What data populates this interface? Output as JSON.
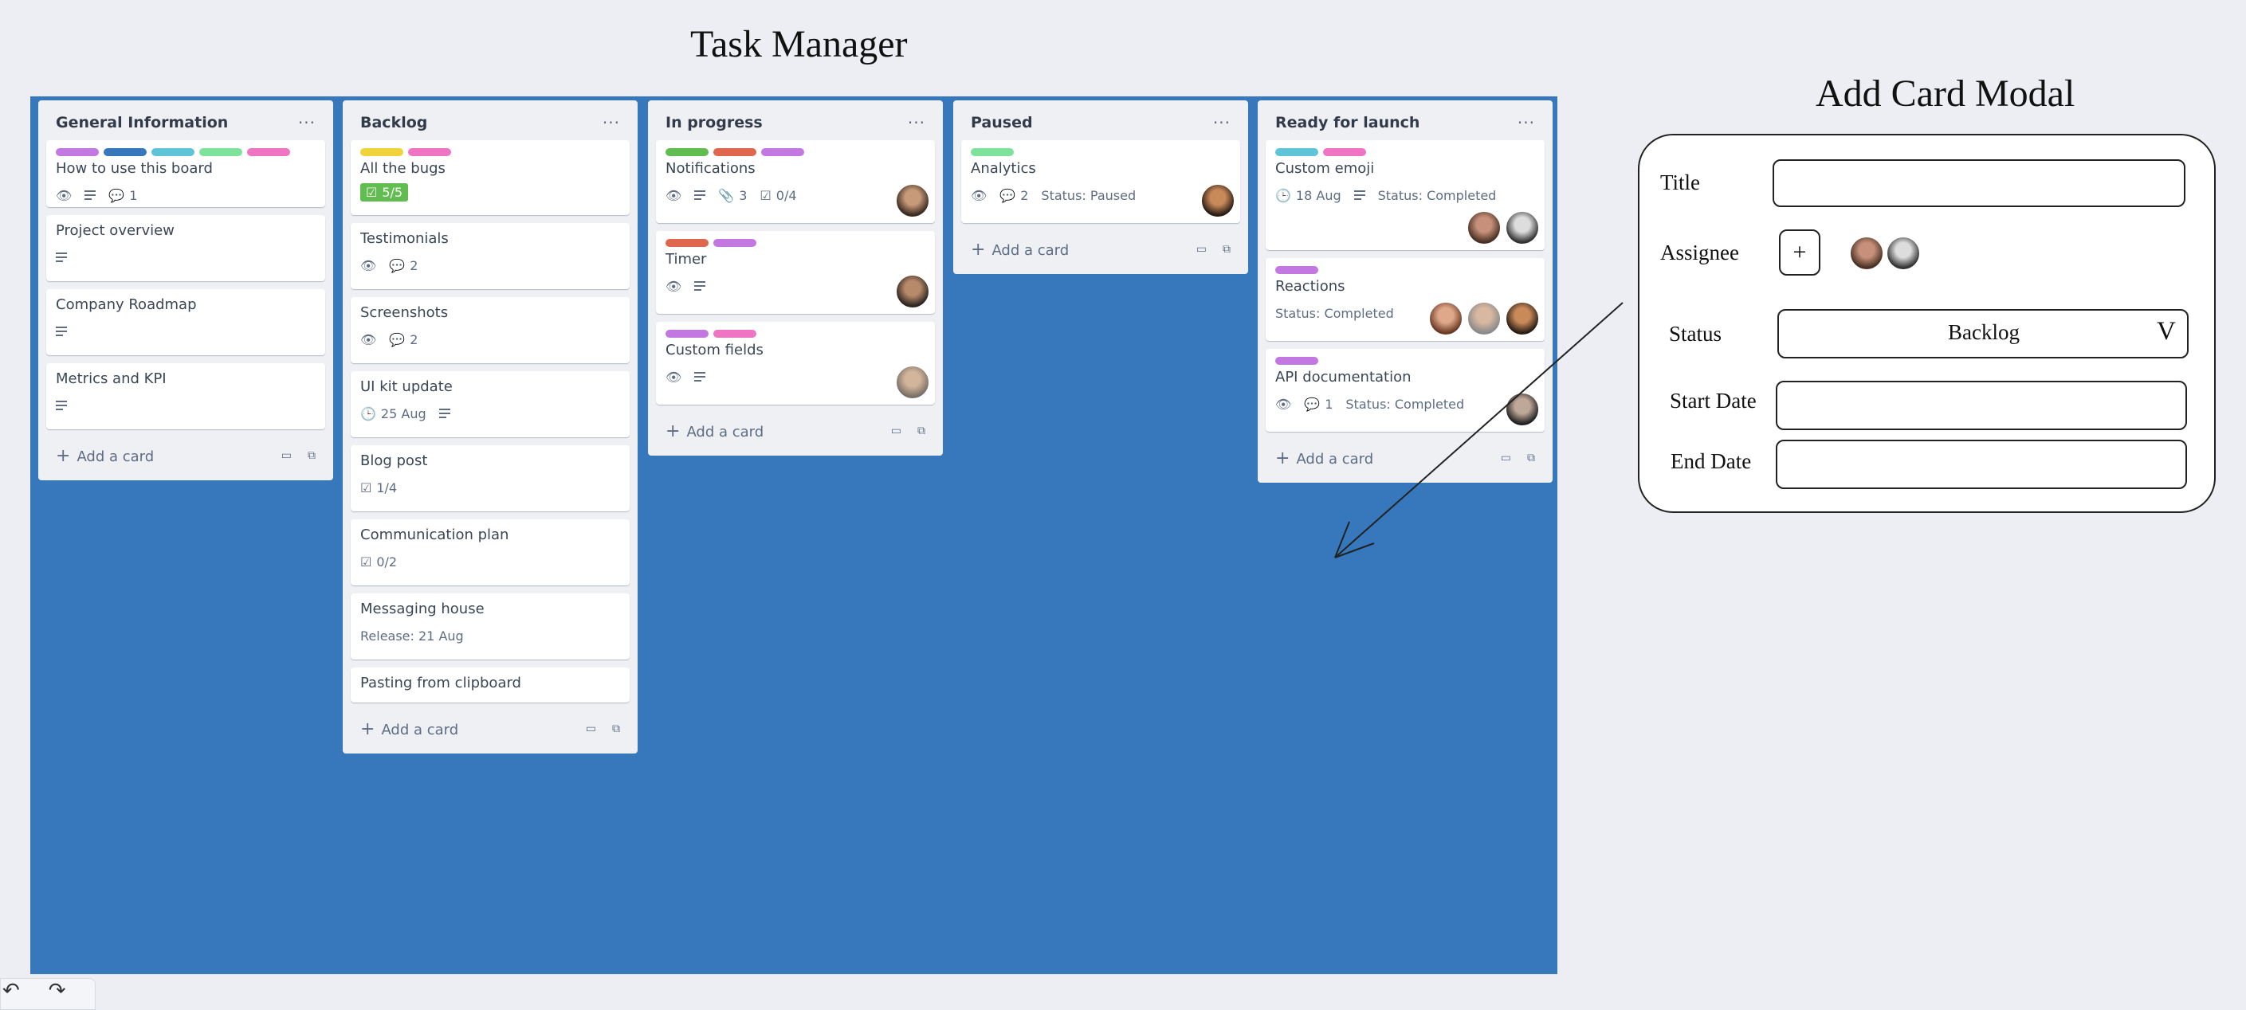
{
  "page_title": "Task Manager",
  "modal_title": "Add Card Modal",
  "colors": {
    "board_bg": "#3778bd",
    "label_purple": "#c377e0",
    "label_blue": "#3778bd",
    "label_cyan": "#5fc4d8",
    "label_green": "#7de39b",
    "label_pink": "#ef75c4",
    "label_yellow": "#f0d23a",
    "label_darkgreen": "#61bd4f",
    "label_red": "#e0664d"
  },
  "lists": [
    {
      "title": "General Information",
      "menu": "···",
      "cards": [
        {
          "title": "How to use this board",
          "comments": "1"
        },
        {
          "title": "Project overview"
        },
        {
          "title": "Company Roadmap"
        },
        {
          "title": "Metrics and KPI"
        }
      ],
      "add_label": "Add a card"
    },
    {
      "title": "Backlog",
      "menu": "···",
      "cards": [
        {
          "title": "All the bugs",
          "checklist": "5/5"
        },
        {
          "title": "Testimonials",
          "comments": "2"
        },
        {
          "title": "Screenshots",
          "comments": "2"
        },
        {
          "title": "UI kit update",
          "due": "25 Aug"
        },
        {
          "title": "Blog post",
          "checklist": "1/4"
        },
        {
          "title": "Communication plan",
          "checklist": "0/2"
        },
        {
          "title": "Messaging house",
          "release": "Release: 21 Aug"
        },
        {
          "title": "Pasting from clipboard"
        }
      ],
      "add_label": "Add a card"
    },
    {
      "title": "In progress",
      "menu": "···",
      "cards": [
        {
          "title": "Notifications",
          "attachments": "3",
          "checklist": "0/4"
        },
        {
          "title": "Timer"
        },
        {
          "title": "Custom fields"
        }
      ],
      "add_label": "Add a card"
    },
    {
      "title": "Paused",
      "menu": "···",
      "cards": [
        {
          "title": "Analytics",
          "comments": "2",
          "status": "Status: Paused"
        }
      ],
      "add_label": "Add a card"
    },
    {
      "title": "Ready for launch",
      "menu": "···",
      "cards": [
        {
          "title": "Custom emoji",
          "due": "18 Aug",
          "status": "Status: Completed"
        },
        {
          "title": "Reactions",
          "status": "Status: Completed"
        },
        {
          "title": "API documentation",
          "comments": "1",
          "status": "Status: Completed"
        }
      ],
      "add_label": "Add a card"
    }
  ],
  "modal": {
    "title_label": "Title",
    "title_value": "",
    "assignee_label": "Assignee",
    "assignee_add": "+",
    "status_label": "Status",
    "status_value": "Backlog",
    "status_chevron": "V",
    "start_label": "Start Date",
    "start_value": "",
    "end_label": "End Date",
    "end_value": ""
  },
  "toolbar": {
    "undo": "↶",
    "redo": "↷"
  },
  "icons": {
    "eye": "👁",
    "comment": "💬",
    "attach": "📎",
    "check": "☑",
    "clock": "🕒",
    "video": "▭",
    "copy": "⧉"
  }
}
